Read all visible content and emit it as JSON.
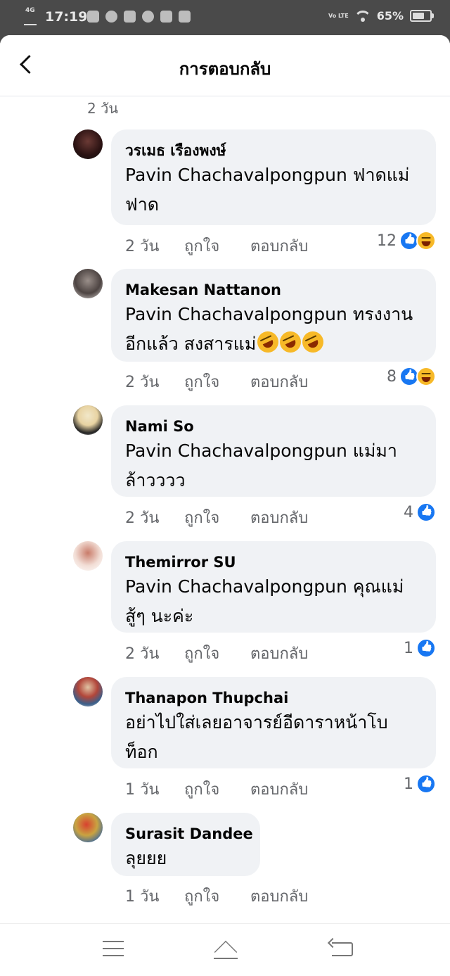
{
  "status_bar": {
    "network": "4G",
    "time": "17:19",
    "volte": "Vo LTE",
    "battery": "65%"
  },
  "header": {
    "title": "การตอบกลับ"
  },
  "previous_time": "2 วัน",
  "actions": {
    "like": "ถูกใจ",
    "reply": "ตอบกลับ"
  },
  "comments": [
    {
      "author": "วรเมธ เรืองพงษ์",
      "lines": [
        "Pavin Chachavalpongpun ฟาดแม่",
        "ฟาด"
      ],
      "time": "2 วัน",
      "reaction_count": "12",
      "reactions": [
        "like-icon",
        "haha-icon"
      ]
    },
    {
      "author": "Makesan Nattanon",
      "lines": [
        "Pavin Chachavalpongpun ทรงงาน",
        "อีกแล้ว สงสารแม่"
      ],
      "time": "2 วัน",
      "reaction_count": "8",
      "reactions": [
        "like-icon",
        "haha-icon"
      ]
    },
    {
      "author": "Nami So",
      "lines": [
        "Pavin Chachavalpongpun แม่มา",
        "ล้าวววว"
      ],
      "time": "2 วัน",
      "reaction_count": "4",
      "reactions": [
        "like-icon"
      ]
    },
    {
      "author": "Themirror SU",
      "lines": [
        "Pavin Chachavalpongpun คุณแม่",
        "สู้ๆ นะค่ะ"
      ],
      "time": "2 วัน",
      "reaction_count": "1",
      "reactions": [
        "like-icon"
      ]
    },
    {
      "author": "Thanapon Thupchai",
      "lines": [
        "อย่าไปใส่เลยอาจารย์อีดาราหน้าโบ",
        "ท็อก"
      ],
      "time": "1 วัน",
      "reaction_count": "1",
      "reactions": [
        "like-icon"
      ]
    },
    {
      "author": "Surasit Dandee",
      "lines": [
        "ลุยยย"
      ],
      "time": "1 วัน",
      "reaction_count": "",
      "reactions": []
    }
  ],
  "colors": {
    "accent": "#1877f2",
    "bubble": "#f0f2f5",
    "muted": "#65676b"
  }
}
